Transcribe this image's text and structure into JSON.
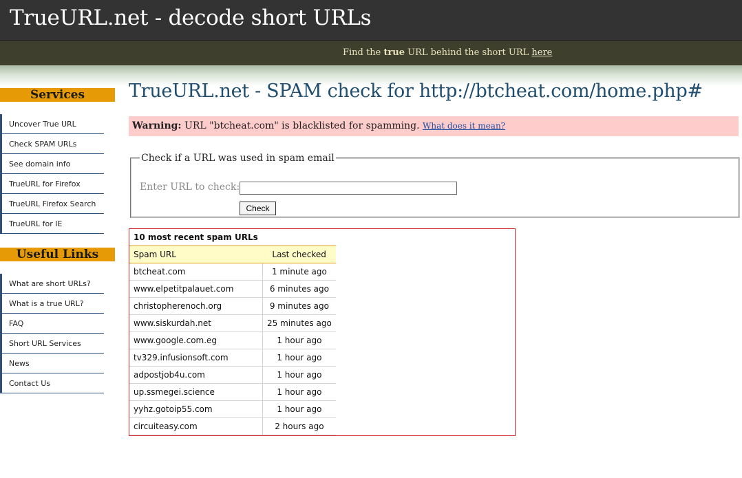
{
  "header": {
    "title": "TrueURL.net - decode short URLs",
    "tagline_prefix": "Find the ",
    "tagline_bold": "true",
    "tagline_middle": " URL behind the short URL ",
    "tagline_link": "here"
  },
  "sidebar": {
    "services_title": "Services",
    "services": [
      {
        "label": "Uncover True URL"
      },
      {
        "label": "Check SPAM URLs"
      },
      {
        "label": "See domain info"
      },
      {
        "label": "TrueURL for Firefox"
      },
      {
        "label": "TrueURL Firefox Search"
      },
      {
        "label": "TrueURL for IE"
      }
    ],
    "links_title": "Useful Links",
    "links": [
      {
        "label": "What are short URLs?"
      },
      {
        "label": "What is a true URL?"
      },
      {
        "label": "FAQ"
      },
      {
        "label": "Short URL Services"
      },
      {
        "label": "News"
      },
      {
        "label": "Contact Us"
      }
    ]
  },
  "main": {
    "title": "TrueURL.net - SPAM check for http://btcheat.com/home.php#",
    "warning": {
      "label": "Warning:",
      "text": " URL \"btcheat.com\" is blacklisted for spamming. ",
      "link": "What does it mean?"
    },
    "form": {
      "legend": "Check if a URL was used in spam email",
      "label": "Enter URL to check:",
      "input_value": "",
      "button": "Check"
    },
    "recent": {
      "caption": "10 most recent spam URLs",
      "headers": [
        "Spam URL",
        "Last checked"
      ],
      "rows": [
        [
          "btcheat.com",
          "1 minute ago"
        ],
        [
          "www.elpetitpalauet.com",
          "6 minutes ago"
        ],
        [
          "christopherenoch.org",
          "9 minutes ago"
        ],
        [
          "www.siskurdah.net",
          "25 minutes ago"
        ],
        [
          "www.google.com.eg",
          "1 hour ago"
        ],
        [
          "tv329.infusionsoft.com",
          "1 hour ago"
        ],
        [
          "adpostjob4u.com",
          "1 hour ago"
        ],
        [
          "up.ssmegei.science",
          "1 hour ago"
        ],
        [
          "yyhz.gotoip55.com",
          "1 hour ago"
        ],
        [
          "circuiteasy.com",
          "2 hours ago"
        ]
      ]
    }
  }
}
